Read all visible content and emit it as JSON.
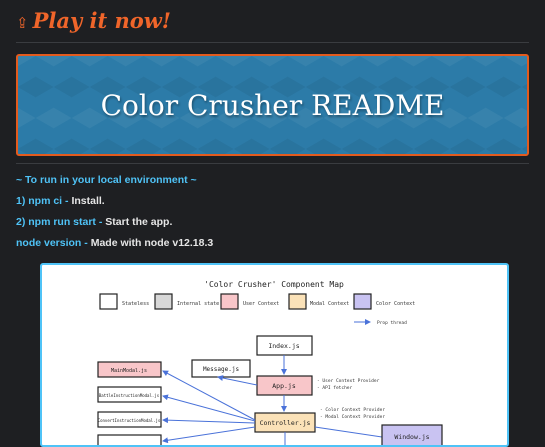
{
  "header": {
    "play_arrow": "⇪",
    "play_label": "Play it now!"
  },
  "banner": {
    "title": "Color Crusher README"
  },
  "instructions": {
    "heading": "~ To run in your local environment ~",
    "step1_cmd": "1) npm ci",
    "step1_sep": " - ",
    "step1_desc": "Install.",
    "step2_cmd": "2) npm run start",
    "step2_sep": " - ",
    "step2_desc": "Start the app.",
    "node_label": "node version",
    "node_sep": " - ",
    "node_desc": "Made with node v12.18.3"
  },
  "diagram": {
    "title": "'Color Crusher' Component Map",
    "legend": [
      {
        "label": "Stateless",
        "color": "#ffffff"
      },
      {
        "label": "Internal state",
        "color": "#d8d8d8"
      },
      {
        "label": "User Context",
        "color": "#f8c6c9"
      },
      {
        "label": "Modal Context",
        "color": "#fbe2b8"
      },
      {
        "label": "Color Context",
        "color": "#c9c3f2"
      }
    ],
    "prop_thread": "Prop thread",
    "nodes": {
      "index": "Index.js",
      "message": "Message.js",
      "app": "App.js",
      "controller": "Controller.js",
      "main_modal": "MainModal.js",
      "battle_modal": "BattleInstructionModal.js",
      "convert_modal": "ConvertInstructionModal.js",
      "window": "Window.js"
    },
    "notes": {
      "app_line1": "- User Context Provider",
      "app_line2": "- API fetcher",
      "controller_line1": "- Color Context Provider",
      "controller_line2": "- Modal Context Provider"
    }
  }
}
